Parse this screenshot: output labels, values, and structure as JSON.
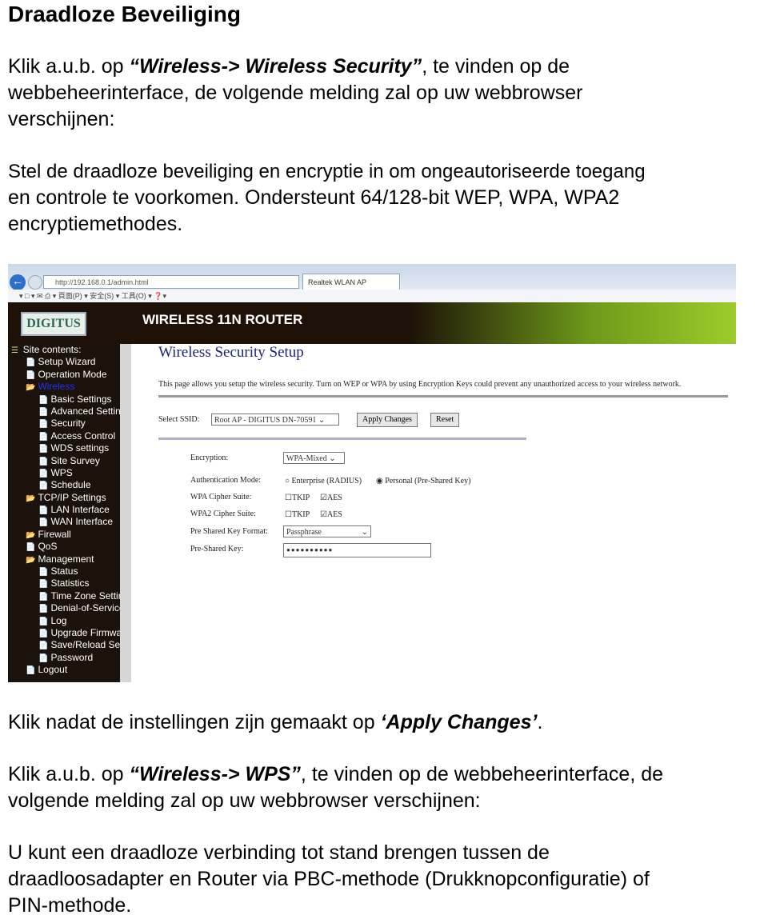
{
  "title": "Draadloze Beveiliging",
  "p1": {
    "a": "Klik a.u.b. op ",
    "b": "“Wireless-> Wireless Security”",
    "c": ", te vinden op de",
    "l2": "webbeheerinterface, de volgende melding zal op uw webbrowser",
    "l3": "verschijnen:"
  },
  "p2": {
    "l1": "Stel de draadloze beveiliging en encryptie in om ongeautoriseerde toegang",
    "l2": "en controle te voorkomen. Ondersteunt 64/128-bit WEP, WPA, WPA2",
    "l3": "encryptiemethodes."
  },
  "browser": {
    "url": "http://192.168.0.1/admin.html",
    "tab": "Realtek WLAN AP Webserver...",
    "toolbar": "▾  □ ▾  ✉  ⎙ ▾  頁面(P) ▾  安全(S) ▾  工具(O) ▾  ❓▾"
  },
  "router": {
    "logo": "DIGITUS",
    "title": "WIRELESS 11N ROUTER",
    "sidebar": [
      "Site contents:",
      "Setup Wizard",
      "Operation Mode",
      "Wireless",
      "Basic Settings",
      "Advanced Settings",
      "Security",
      "Access Control",
      "WDS settings",
      "Site Survey",
      "WPS",
      "Schedule",
      "TCP/IP Settings",
      "LAN Interface",
      "WAN Interface",
      "Firewall",
      "QoS",
      "Management",
      "Status",
      "Statistics",
      "Time Zone Setting",
      "Denial-of-Service",
      "Log",
      "Upgrade Firmware",
      "Save/Reload Settings",
      "Password",
      "Logout"
    ],
    "page_title": "Wireless Security Setup",
    "description": "This page allows you setup the wireless security. Turn on WEP or WPA by using Encryption Keys could prevent any unauthorized access to your wireless network.",
    "ssid_label": "Select SSID:",
    "ssid_value": "Root AP - DIGITUS DN-70591",
    "apply": "Apply Changes",
    "reset": "Reset",
    "encryption_label": "Encryption:",
    "encryption_value": "WPA-Mixed",
    "auth_label": "Authentication Mode:",
    "auth_enterprise": "Enterprise (RADIUS)",
    "auth_personal": "Personal (Pre-Shared Key)",
    "wpa_label": "WPA Cipher Suite:",
    "wpa2_label": "WPA2 Cipher Suite:",
    "tkip": "TKIP",
    "aes": "AES",
    "pskf_label": "Pre Shared Key Format:",
    "pskf_value": "Passphrase",
    "psk_label": "Pre-Shared Key:",
    "psk_value": "●●●●●●●●●●"
  },
  "p3": {
    "a": "Klik nadat de instellingen zijn gemaakt op ",
    "b": "‘Apply Changes’",
    "c": "."
  },
  "p4": {
    "a": "Klik a.u.b. op ",
    "b": "“Wireless-> WPS”",
    "c": ", te vinden op de webbeheerinterface, de",
    "l2": "volgende melding zal op uw webbrowser verschijnen:"
  },
  "p5": {
    "l1": "U kunt een draadloze verbinding tot stand brengen tussen de",
    "l2": "draadloosadapter en Router via PBC-methode (Drukknopconfiguratie) of",
    "l3": "PIN-methode."
  }
}
